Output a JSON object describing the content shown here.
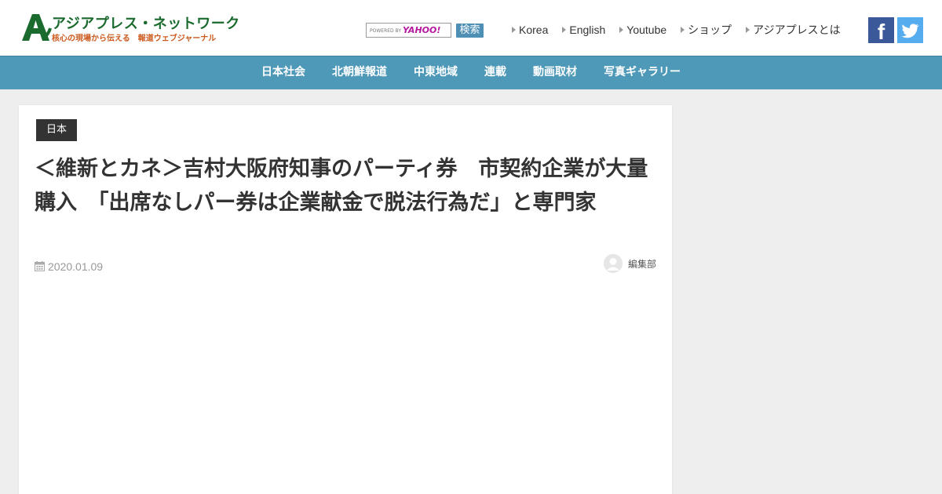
{
  "brand": {
    "title": "アジアプレス・ネットワーク",
    "subtitle": "核心の現場から伝える　報道ウェブジャーナル",
    "colors": {
      "title": "#1b6a2e",
      "subtitle": "#cc5a1e",
      "mark": "#1b6a2e"
    }
  },
  "search": {
    "powered_by": "POWERED BY",
    "provider": "YAHOO!",
    "button_label": "検索"
  },
  "top_links": [
    "Korea",
    "English",
    "Youtube",
    "ショップ",
    "アジアプレスとは"
  ],
  "social": {
    "facebook_glyph": "f",
    "icons": [
      "facebook-icon",
      "twitter-icon"
    ],
    "colors": {
      "facebook": "#3b5998",
      "twitter": "#55acee"
    }
  },
  "nav": {
    "items": [
      "日本社会",
      "北朝鮮報道",
      "中東地域",
      "連載",
      "動画取材",
      "写真ギャラリー"
    ],
    "color": "#4e98b8"
  },
  "article": {
    "category": "日本",
    "title": "＜維新とカネ＞吉村大阪府知事のパーティ券　市契約企業が大量購入　「出席なしパー券は企業献金で脱法行為だ」と専門家",
    "date": "2020.01.09",
    "author": "編集部"
  }
}
